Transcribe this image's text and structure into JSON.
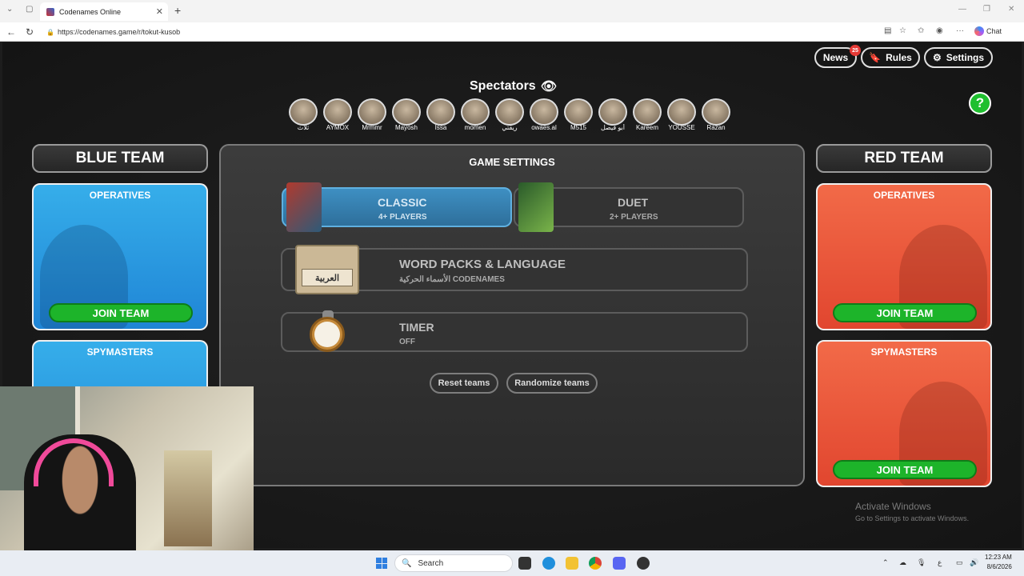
{
  "browser": {
    "tab_title": "Codenames Online",
    "url": "https://codenames.game/r/tokut-kusob",
    "chat_label": "Chat"
  },
  "topbar": {
    "news_label": "News",
    "news_badge": "25",
    "rules_label": "Rules",
    "settings_label": "Settings",
    "help_label": "?"
  },
  "spectators": {
    "title": "Spectators",
    "names": [
      "ثلاث",
      "AYMOX",
      "Mrmmr",
      "Mayosh",
      "Issa",
      "momen",
      "ريقتي",
      "owaes.al",
      "M515",
      "أبو فيصل",
      "Kareem",
      "YOUSSE",
      "Razan"
    ]
  },
  "blue_team": {
    "title": "BLUE TEAM",
    "operatives_label": "OPERATIVES",
    "spymasters_label": "SPYMASTERS",
    "join_label": "JOIN TEAM"
  },
  "red_team": {
    "title": "RED TEAM",
    "operatives_label": "OPERATIVES",
    "spymasters_label": "SPYMASTERS",
    "join_label": "JOIN TEAM",
    "join_label_2": "JOIN TEAM"
  },
  "game_settings": {
    "title": "GAME SETTINGS",
    "classic": {
      "title": "CLASSIC",
      "subtitle": "4+ PLAYERS"
    },
    "duet": {
      "title": "DUET",
      "subtitle": "2+ PLAYERS"
    },
    "word_packs": {
      "title": "WORD PACKS & LANGUAGE",
      "subtitle": "الأسماء الحركية CODENAMES",
      "language_badge": "العربية"
    },
    "timer": {
      "title": "TIMER",
      "subtitle": "OFF"
    },
    "reset_label": "Reset teams",
    "randomize_label": "Randomize teams"
  },
  "windows": {
    "activate_title": "Activate Windows",
    "activate_sub": "Go to Settings to activate Windows.",
    "search_label": "Search",
    "time": "12:23 AM",
    "date": "8/6/2026",
    "lang": "ع"
  },
  "colors": {
    "blue_team": "#2a9be2",
    "red_team": "#e9553a",
    "join_green": "#1db42a",
    "help_green": "#1fbf2f"
  }
}
